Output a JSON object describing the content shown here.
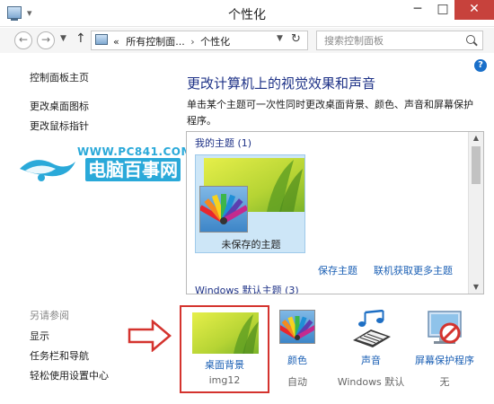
{
  "window": {
    "title": "个性化"
  },
  "address_bar": {
    "chevrons": "«",
    "crumbs": [
      "所有控制面...",
      "个性化"
    ],
    "search_placeholder": "搜索控制面板"
  },
  "sidebar": {
    "items": [
      "控制面板主页",
      "更改桌面图标",
      "更改鼠标指针"
    ]
  },
  "see_also": {
    "title": "另请参阅",
    "items": [
      "显示",
      "任务栏和导航",
      "轻松使用设置中心"
    ]
  },
  "watermark": {
    "url": "WWW.PC841.COM",
    "name": "电脑百事网"
  },
  "main": {
    "title": "更改计算机上的视觉效果和声音",
    "description": "单击某个主题可一次性同时更改桌面背景、颜色、声音和屏幕保护程序。"
  },
  "theme_panel": {
    "my_themes_heading": "我的主题 (1)",
    "unsaved_theme_label": "未保存的主题",
    "save_theme_link": "保存主题",
    "get_more_link": "联机获取更多主题",
    "default_heading": "Windows 默认主题 (3)"
  },
  "bottom_bar": {
    "items": [
      {
        "label": "桌面背景",
        "value": "img12",
        "icon": "desktop-background-icon"
      },
      {
        "label": "颜色",
        "value": "自动",
        "icon": "color-icon"
      },
      {
        "label": "声音",
        "value": "Windows 默认",
        "icon": "sound-icon"
      },
      {
        "label": "屏幕保护程序",
        "value": "无",
        "icon": "screensaver-icon"
      }
    ]
  },
  "colors": {
    "link": "#1a5fb4",
    "heading": "#1e3287",
    "highlight_border": "#d4332e",
    "close_button": "#c7423c",
    "watermark": "#2aa9d9"
  }
}
